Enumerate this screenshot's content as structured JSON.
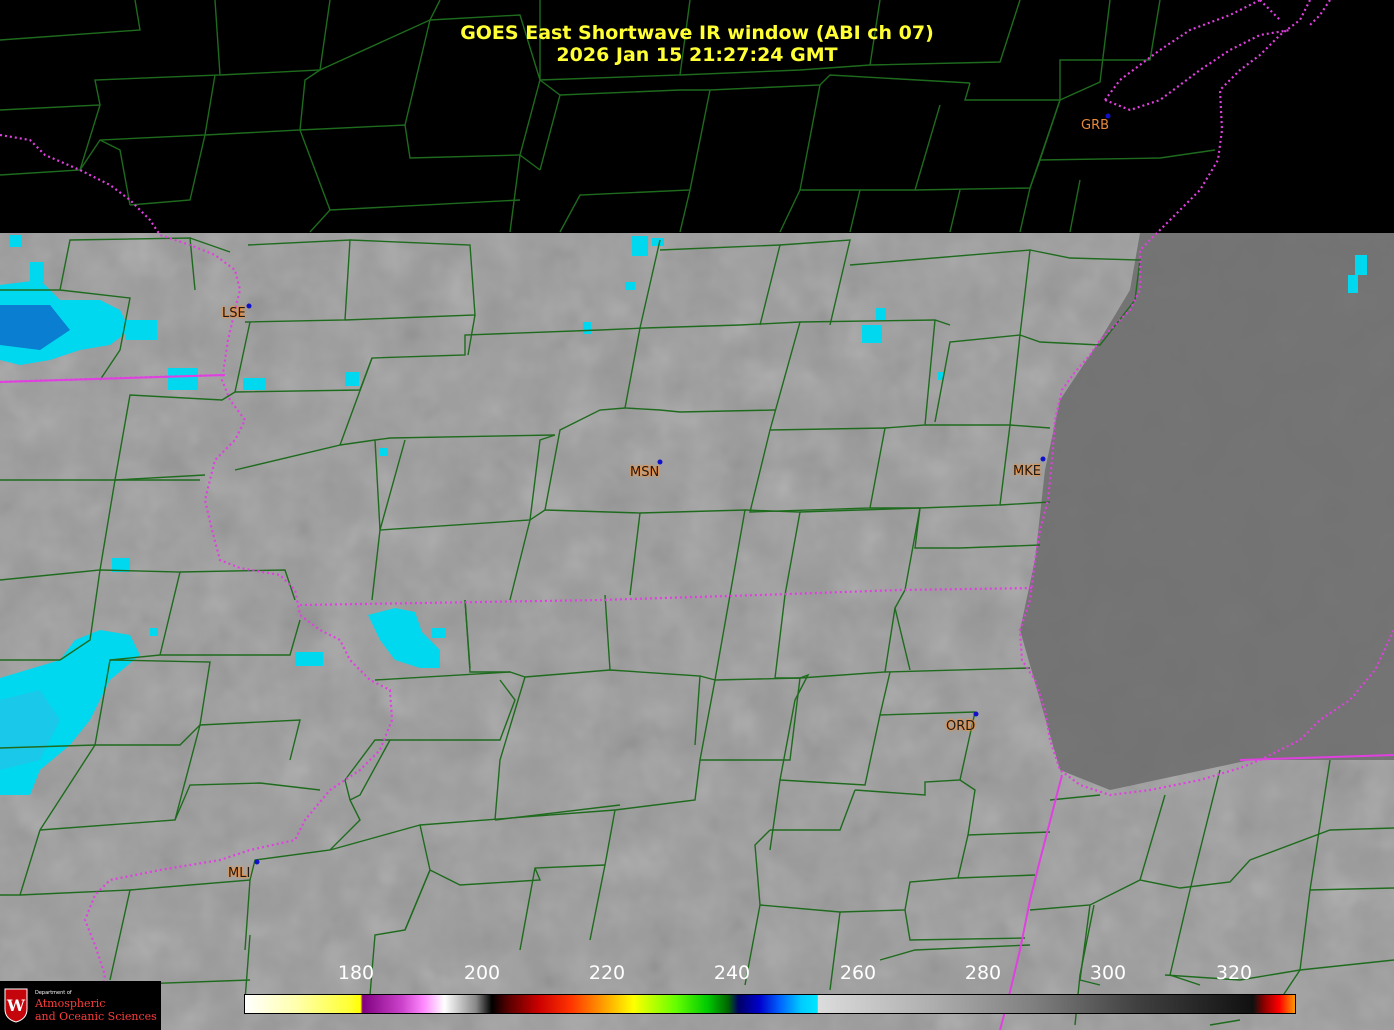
{
  "header": {
    "title": "GOES East Shortwave IR window (ABI ch 07)",
    "timestamp": "2026 Jan 15  21:27:24 GMT"
  },
  "stations": [
    {
      "id": "GRB",
      "label": "GRB"
    },
    {
      "id": "LSE",
      "label": "LSE"
    },
    {
      "id": "MSN",
      "label": "MSN"
    },
    {
      "id": "MKE",
      "label": "MKE"
    },
    {
      "id": "ORD",
      "label": "ORD"
    },
    {
      "id": "MLI",
      "label": "MLI"
    }
  ],
  "colorbar": {
    "ticks": [
      "180",
      "200",
      "220",
      "240",
      "260",
      "280",
      "300",
      "320"
    ]
  },
  "logo": {
    "department": "Department of",
    "line1": "Atmospheric",
    "line2": "and Oceanic Sciences"
  },
  "colors": {
    "title": "#ffff33",
    "county_lines": "#1e6b1e",
    "state_lines": "#e040e0",
    "station_label": "#ff8c2a",
    "station_dot": "#1010cc",
    "cloud_tops": "#00d8f0"
  }
}
